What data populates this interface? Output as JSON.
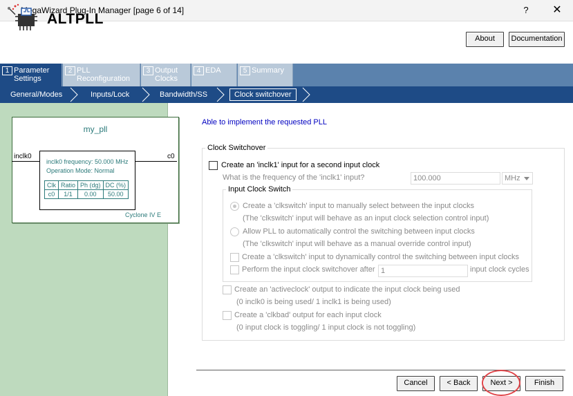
{
  "window": {
    "title": "MegaWizard Plug-In Manager [page 6 of 14]",
    "help_glyph": "?",
    "close_glyph": "✕"
  },
  "header": {
    "title": "ALTPLL",
    "about_label": "About",
    "documentation_label": "Documentation"
  },
  "main_tabs": [
    {
      "num": "1",
      "label_line1": "Parameter",
      "label_line2": "Settings",
      "active": true
    },
    {
      "num": "2",
      "label_line1": "PLL",
      "label_line2": "Reconfiguration",
      "active": false
    },
    {
      "num": "3",
      "label_line1": "Output",
      "label_line2": "Clocks",
      "active": false
    },
    {
      "num": "4",
      "label_line1": "EDA",
      "label_line2": "",
      "active": false
    },
    {
      "num": "5",
      "label_line1": "Summary",
      "label_line2": "",
      "active": false
    }
  ],
  "sub_tabs": [
    "General/Modes",
    "Inputs/Lock",
    "Bandwidth/SS",
    "Clock switchover"
  ],
  "active_sub_tab": "Clock switchover",
  "diagram": {
    "name": "my_pll",
    "input": "inclk0",
    "output": "c0",
    "frequency_text": "inclk0 frequency: 50.000 MHz",
    "mode_text": "Operation Mode: Normal",
    "table_headers": [
      "Clk",
      "Ratio",
      "Ph (dg)",
      "DC (%)"
    ],
    "table_rows": [
      [
        "c0",
        "1/1",
        "0.00",
        "50.00"
      ]
    ],
    "device": "Cyclone IV E"
  },
  "status": "Able to implement the requested PLL",
  "clock_switchover": {
    "group_title": "Clock Switchover",
    "create_inclk1_label": "Create an 'inclk1' input for a second input clock",
    "create_inclk1_checked": false,
    "freq_question": "What is the frequency of the 'inclk1' input?",
    "freq_value": "100.000",
    "freq_unit": "MHz",
    "input_clock_switch_title": "Input Clock Switch",
    "radio_manual_label": "Create a 'clkswitch' input to manually select between the input clocks",
    "radio_manual_note": "(The 'clkswitch' input will behave as an input clock selection control input)",
    "radio_auto_label": "Allow PLL to automatically control the switching between input clocks",
    "radio_auto_note": "(The 'clkswitch' input will behave as a manual override control input)",
    "dynamic_label": "Create a 'clkswitch' input to dynamically control the switching between input clocks",
    "perform_label": "Perform the input clock switchover after",
    "perform_value": "1",
    "perform_suffix": "input clock cycles",
    "activeclock_label": "Create an 'activeclock' output to indicate the input clock being used",
    "activeclock_note": "(0 inclk0 is being used/ 1 inclk1 is being used)",
    "clkbad_label": "Create a 'clkbad' output for each input clock",
    "clkbad_note": "(0 input clock is toggling/ 1 input clock is not toggling)"
  },
  "footer": {
    "cancel_label": "Cancel",
    "back_label": "< Back",
    "next_label": "Next >",
    "finish_label": "Finish"
  },
  "colors": {
    "tab_active": "#1e4b86",
    "tab_inactive": "#b9c9d9",
    "left_pane": "#bedabe",
    "status_text": "#0000c0",
    "highlight": "#e0464a"
  }
}
